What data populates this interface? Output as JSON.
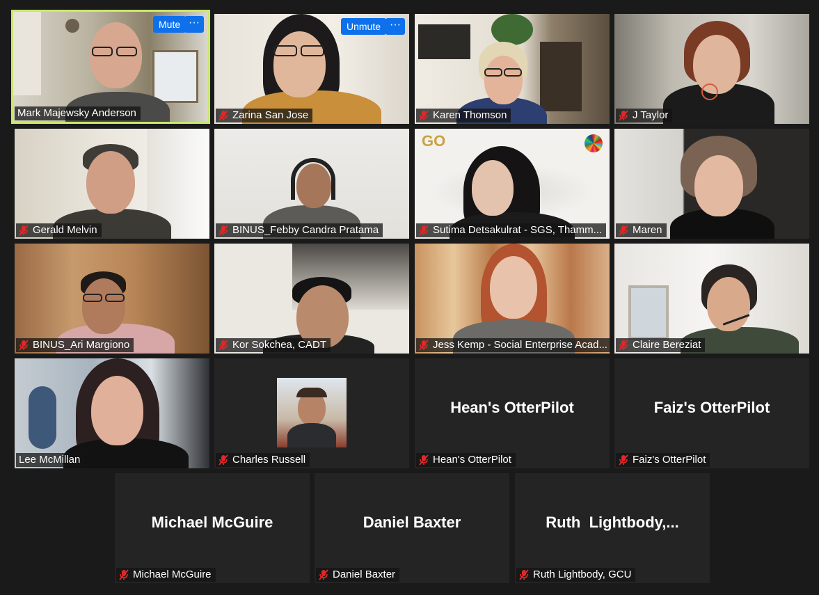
{
  "controls": {
    "mute_label": "Mute",
    "unmute_label": "Unmute",
    "more_label": "···"
  },
  "participants": [
    {
      "name": "Mark Majewsky Anderson",
      "muted": false,
      "active": true
    },
    {
      "name": "Zarina San Jose",
      "muted": true
    },
    {
      "name": "Karen Thomson",
      "muted": true
    },
    {
      "name": "J Taylor",
      "muted": true
    },
    {
      "name": "Gerald Melvin",
      "muted": true
    },
    {
      "name": "BINUS_Febby Candra Pratama",
      "muted": true
    },
    {
      "name": "Sutima Detsakulrat - SGS, Thamm...",
      "muted": true
    },
    {
      "name": "Maren",
      "muted": true
    },
    {
      "name": "BINUS_Ari Margiono",
      "muted": true
    },
    {
      "name": "Kor Sokchea, CADT",
      "muted": true
    },
    {
      "name": "Jess Kemp - Social Enterprise Acad...",
      "muted": true
    },
    {
      "name": "Claire Bereziat",
      "muted": true
    },
    {
      "name": "Lee McMillan",
      "muted": false
    },
    {
      "name": "Charles Russell",
      "muted": true
    },
    {
      "name": "Hean's OtterPilot",
      "muted": true,
      "display": "Hean's OtterPilot"
    },
    {
      "name": "Faiz's OtterPilot",
      "muted": true,
      "display": "Faiz's OtterPilot"
    },
    {
      "name": "Michael McGuire",
      "muted": true,
      "display": "Michael McGuire"
    },
    {
      "name": "Daniel Baxter",
      "muted": true,
      "display": "Daniel Baxter"
    },
    {
      "name": "Ruth Lightbody, GCU",
      "muted": true,
      "display": "Ruth  Lightbody,..."
    }
  ],
  "sutima_logo": "GO",
  "colors": {
    "active_border": "#c9e86a",
    "button_blue": "#0e71eb",
    "mic_red": "#e02828",
    "tile_bg": "#242424"
  }
}
